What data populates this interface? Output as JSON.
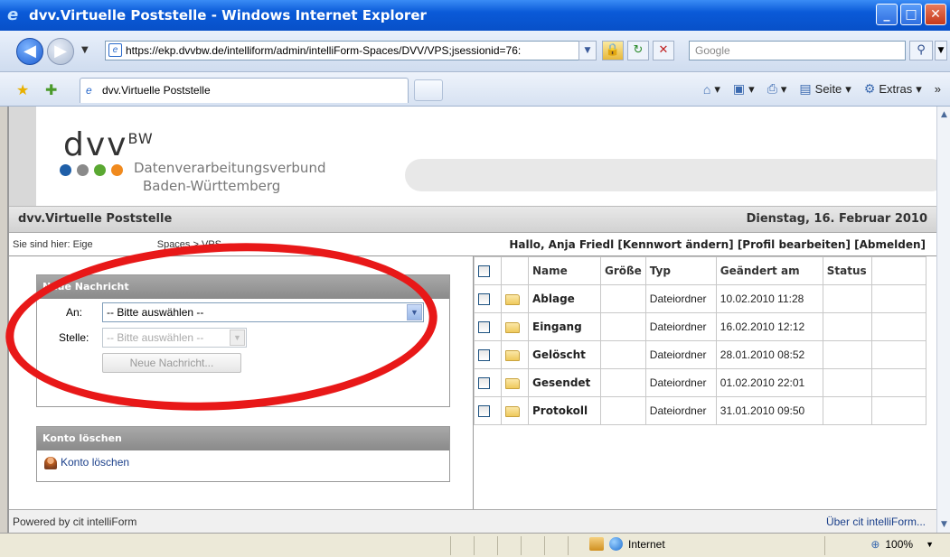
{
  "window": {
    "title": "dvv.Virtuelle Poststelle - Windows Internet Explorer",
    "buttons": {
      "minimize": "_",
      "maximize": "□",
      "close": "✕"
    }
  },
  "browser": {
    "address": "https://ekp.dvvbw.de/intelliform/admin/intelliForm-Spaces/DVV/VPS;jsessionid=76:",
    "search_placeholder": "Google",
    "tab_title": "dvv.Virtuelle Poststelle",
    "commands": {
      "page": "Seite",
      "tools": "Extras"
    }
  },
  "header": {
    "logo_text": "dvv",
    "logo_sup": "BW",
    "logo_line1": "Datenverarbeitungsverbund",
    "logo_line2": "Baden-Württemberg",
    "dot_colors": [
      "#1f5fa8",
      "#8a8a8a",
      "#5aa832",
      "#f08a1e"
    ]
  },
  "appbar": {
    "title": "dvv.Virtuelle Poststelle",
    "date": "Dienstag, 16. Februar 2010"
  },
  "crumb": {
    "prefix": "Sie sind hier: Eige",
    "rest": "Spaces > VPS"
  },
  "greeting": "Hallo, Anja Friedl [Kennwort ändern] [Profil bearbeiten] [Abmelden]",
  "new_message": {
    "heading": "Neue Nachricht",
    "to_label": "An:",
    "to_value": "-- Bitte auswählen --",
    "office_label": "Stelle:",
    "office_value": "-- Bitte auswählen --",
    "button": "Neue Nachricht..."
  },
  "delete_account": {
    "heading": "Konto löschen",
    "link": "Konto löschen"
  },
  "files": {
    "columns": [
      "Name",
      "Größe",
      "Typ",
      "Geändert am",
      "Status"
    ],
    "rows": [
      {
        "name": "Ablage",
        "size": "",
        "type": "Dateiordner",
        "modified": "10.02.2010 11:28",
        "status": ""
      },
      {
        "name": "Eingang",
        "size": "",
        "type": "Dateiordner",
        "modified": "16.02.2010 12:12",
        "status": ""
      },
      {
        "name": "Gelöscht",
        "size": "",
        "type": "Dateiordner",
        "modified": "28.01.2010 08:52",
        "status": ""
      },
      {
        "name": "Gesendet",
        "size": "",
        "type": "Dateiordner",
        "modified": "01.02.2010 22:01",
        "status": ""
      },
      {
        "name": "Protokoll",
        "size": "",
        "type": "Dateiordner",
        "modified": "31.01.2010 09:50",
        "status": ""
      }
    ]
  },
  "footer": {
    "left": "Powered by cit intelliForm",
    "right": "Über cit intelliForm..."
  },
  "status": {
    "zone": "Internet",
    "zoom": "100%"
  }
}
